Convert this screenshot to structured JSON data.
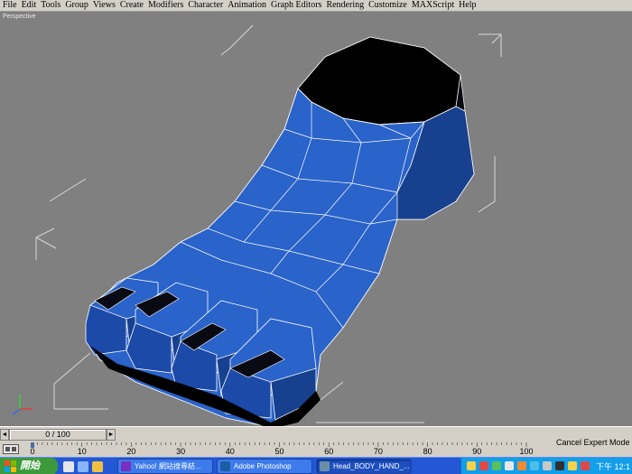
{
  "menu": [
    "File",
    "Edit",
    "Tools",
    "Group",
    "Views",
    "Create",
    "Modifiers",
    "Character",
    "Animation",
    "Graph Editors",
    "Rendering",
    "Customize",
    "MAXScript",
    "Help"
  ],
  "viewport": {
    "label": "Perspective"
  },
  "timeline": {
    "frame_display": "0 / 100",
    "ticks": [
      "0",
      "10",
      "20",
      "30",
      "40",
      "50",
      "60",
      "70",
      "80",
      "90",
      "100"
    ],
    "status": "Cancel Expert Mode"
  },
  "taskbar": {
    "start_label": "開始",
    "tasks": [
      "Yahoo! 網站搜尋結...",
      "Adobe Photoshop",
      "Head_BODY_HAND_..."
    ],
    "clock": "下午 12:1"
  },
  "colors": {
    "viewport_bg": "#808080",
    "mesh_blue": "#2a63c9",
    "taskbar": "#2457d4",
    "start": "#3c9a3c"
  }
}
